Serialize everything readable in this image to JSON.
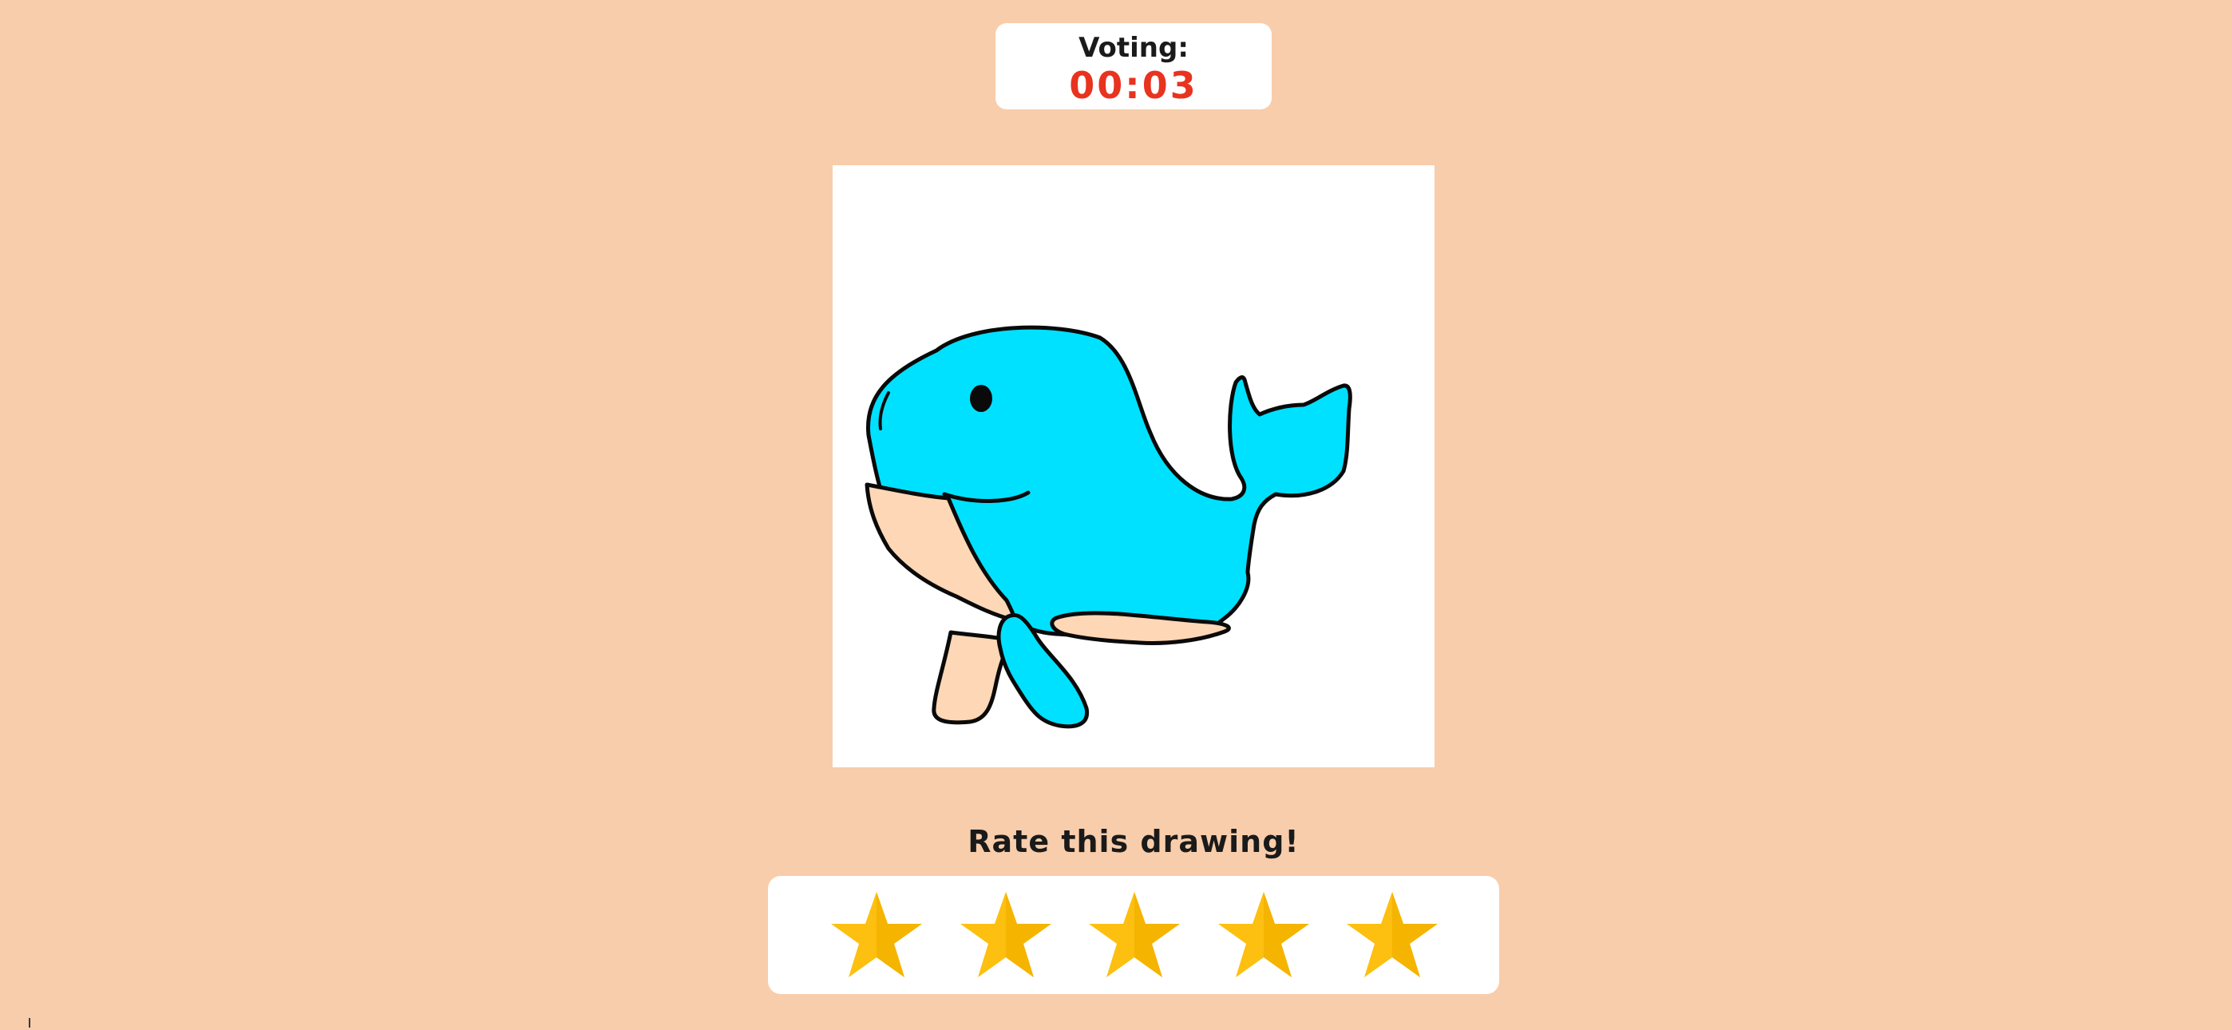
{
  "voting": {
    "label": "Voting:",
    "time_remaining": "00:03",
    "time_color": "#e8331f"
  },
  "drawing": {
    "subject_icon": "whale-drawing-icon",
    "background": "#ffffff",
    "colors": {
      "body": "#00e1ff",
      "belly": "#fdd7b6",
      "outline": "#0a0a0a"
    }
  },
  "rating": {
    "prompt": "Rate this drawing!",
    "max_stars": 5,
    "star_icon": "star-icon",
    "star_color": "#fdbf10",
    "star_shade": "#f5b400"
  },
  "theme": {
    "background": "#f8cdab",
    "card": "#ffffff"
  }
}
